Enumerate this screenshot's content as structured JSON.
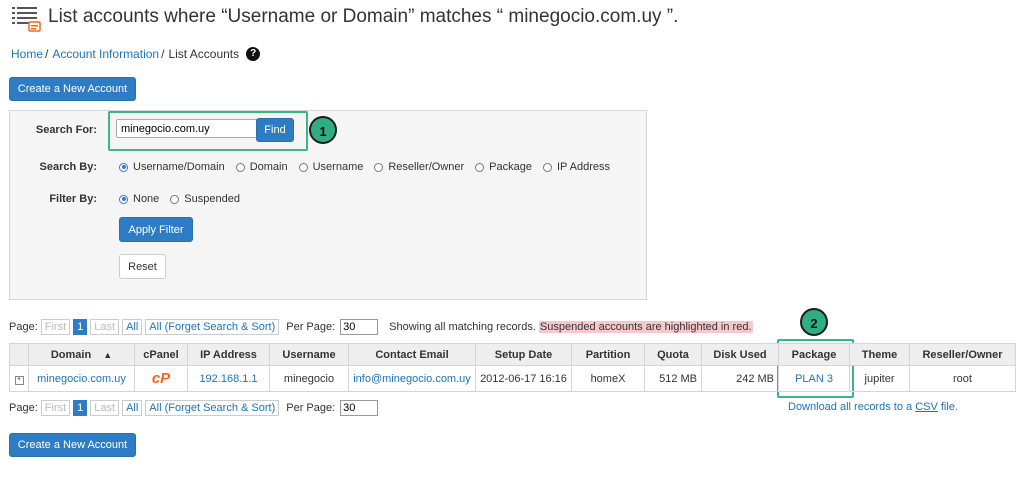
{
  "header": {
    "title": "List accounts where “Username or Domain” matches “ minegocio.com.uy ”.",
    "breadcrumb": {
      "home": "Home",
      "account_info": "Account Information",
      "current": "List Accounts",
      "sep": "/"
    },
    "help_glyph": "?"
  },
  "buttons": {
    "create_account": "Create a New Account",
    "find": "Find",
    "apply_filter": "Apply Filter",
    "reset": "Reset"
  },
  "search": {
    "label": "Search For:",
    "value": "minegocio.com.uy",
    "search_by_label": "Search By:",
    "search_by_options": [
      "Username/Domain",
      "Domain",
      "Username",
      "Reseller/Owner",
      "Package",
      "IP Address"
    ],
    "search_by_selected": "Username/Domain",
    "filter_by_label": "Filter By:",
    "filter_by_options": [
      "None",
      "Suspended"
    ],
    "filter_by_selected": "None"
  },
  "callouts": {
    "one": "1",
    "two": "2"
  },
  "pager": {
    "page_label": "Page:",
    "first": "First",
    "current": "1",
    "last": "Last",
    "all": "All",
    "all_forget": "All (Forget Search & Sort)",
    "per_page_label": "Per Page:",
    "per_page_value": "30",
    "status": "Showing all matching records.",
    "suspended_note": "Suspended accounts are highlighted in red."
  },
  "table": {
    "columns": [
      "Domain",
      "cPanel",
      "IP Address",
      "Username",
      "Contact Email",
      "Setup Date",
      "Partition",
      "Quota",
      "Disk Used",
      "Package",
      "Theme",
      "Reseller/Owner"
    ],
    "sort_indicator": "▲",
    "rows": [
      {
        "expand": "+",
        "domain": "minegocio.com.uy",
        "cpanel_logo": "cP",
        "ip": "192.168.1.1",
        "username": "minegocio",
        "email": "info@minegocio.com.uy",
        "setup_date": "2012-06-17 16:16",
        "partition": "homeX",
        "quota": "512 MB",
        "disk_used": "242 MB",
        "package": "PLAN 3",
        "theme": "jupiter",
        "owner": "root"
      }
    ]
  },
  "csv": {
    "prefix": "Download all records to a ",
    "link": "CSV",
    "suffix": " file."
  },
  "colors": {
    "accent": "#2e7dc4",
    "callout_green": "#2fae84",
    "suspended_red": "#f4c9cb",
    "cpanel_orange": "#f26522"
  }
}
